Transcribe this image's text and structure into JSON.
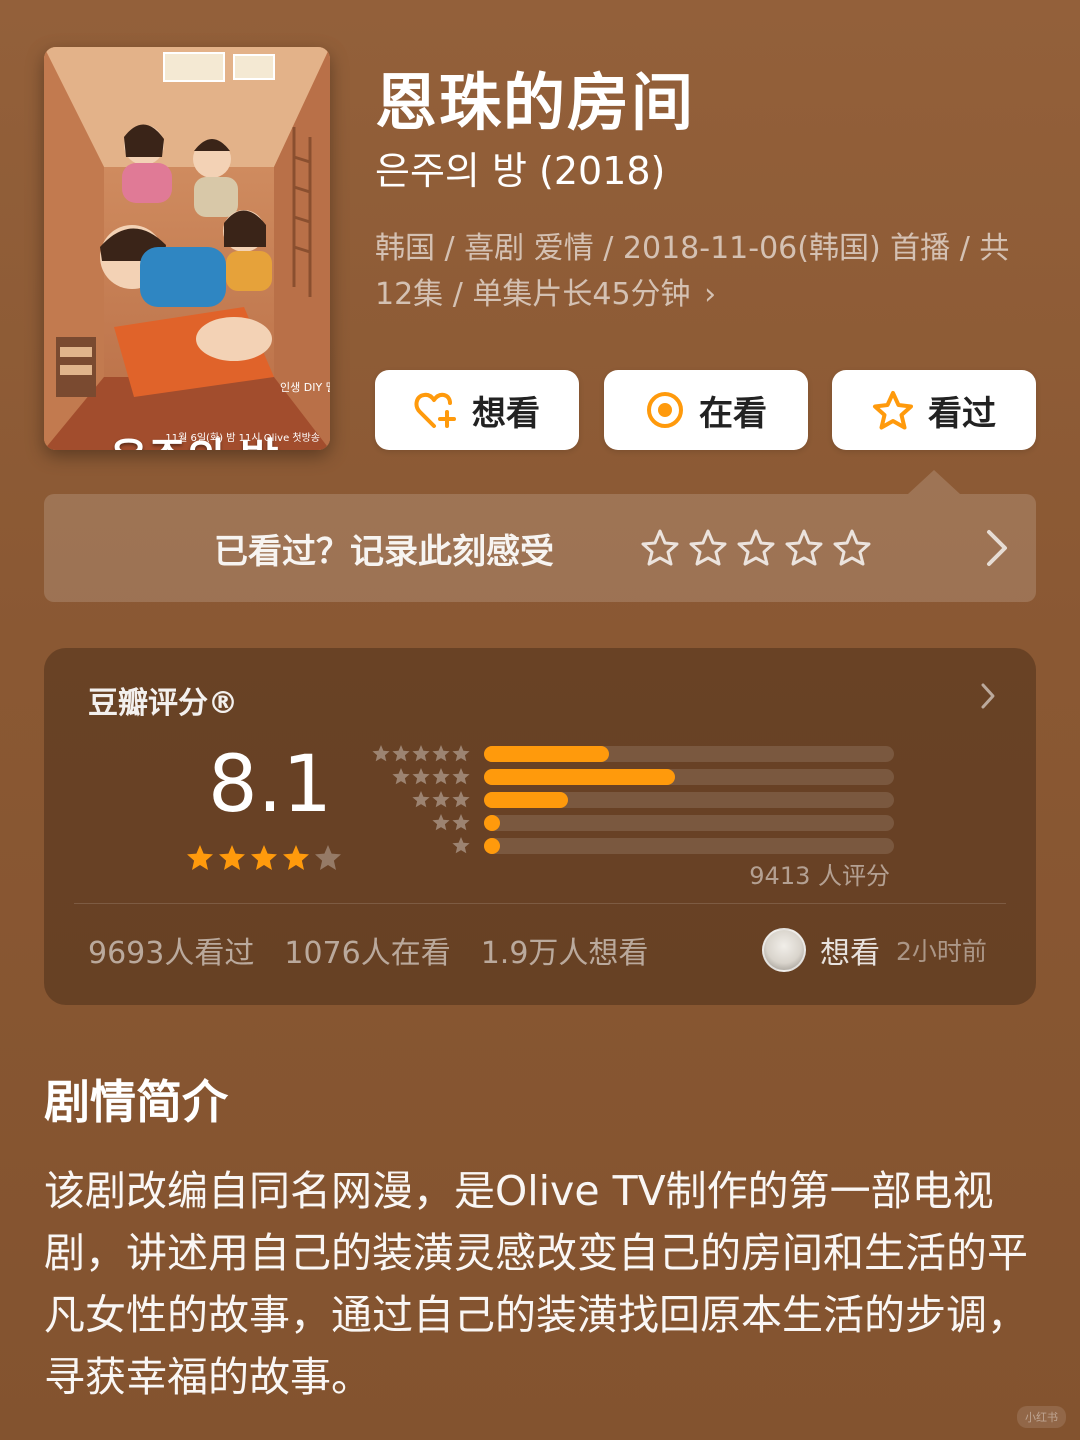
{
  "show": {
    "title": "恩珠的房间",
    "original_title": "은주의 방 (2018)",
    "meta": "韩国 / 喜剧 爱情 / 2018-11-06(韩国) 首播 / 共12集 / 单集片长45分钟",
    "meta_chevron": "›"
  },
  "poster": {
    "title_text": "은주의 방",
    "tagline": "인생 DIY 멜로디",
    "airing": "11월 6일(화) 밤 11시 Olive 첫방송"
  },
  "actions": {
    "wish_label": "想看",
    "doing_label": "在看",
    "done_label": "看过",
    "accent_color": "#ff9a0c"
  },
  "record": {
    "prompt": "已看过？记录此刻感受",
    "stars": 5
  },
  "rating": {
    "label": "豆瓣评分®",
    "score": "8.1",
    "stars_filled": 4,
    "stars_total": 5,
    "distribution": [
      {
        "stars": 5,
        "percent": 30.5
      },
      {
        "stars": 4,
        "percent": 46.5
      },
      {
        "stars": 3,
        "percent": 20.5
      },
      {
        "stars": 2,
        "percent": 2.0
      },
      {
        "stars": 1,
        "percent": 0.5
      }
    ],
    "count_text": "9413 人评分",
    "watched_text": "9693人看过",
    "watching_text": "1076人在看",
    "wish_text": "1.9万人想看",
    "friend_status": "想看",
    "friend_time": "2小时前"
  },
  "intro": {
    "heading": "剧情简介",
    "body": "该剧改编自同名网漫，是Olive TV制作的第一部电视剧，讲述用自己的装潢灵感改变自己的房间和生活的平凡女性的故事，通过自己的装潢找回原本生活的步调，寻获幸福的故事。"
  },
  "watermark": "小红书"
}
